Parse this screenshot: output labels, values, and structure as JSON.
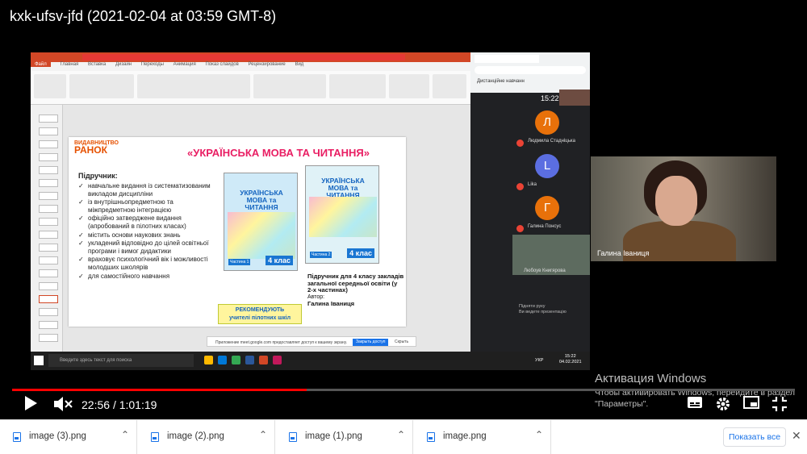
{
  "video": {
    "title": "kxk-ufsv-jfd (2021-02-04 at 03:59 GMT-8)",
    "current_time": "22:56",
    "separator": "/",
    "duration": "1:01:19",
    "progress_fraction": 0.376
  },
  "ppt": {
    "tabs": [
      "Файл",
      "Главная",
      "Вставка",
      "Дизайн",
      "Переходы",
      "Анимация",
      "Показ слайдов",
      "Рецензирование",
      "Вид"
    ],
    "slide": {
      "brand_top": "ВИДАВНИЦТВО",
      "brand": "РАНОК",
      "title": "«УКРАЇНСЬКА МОВА ТА ЧИТАННЯ»",
      "subtitle": "Підручник:",
      "bullets": [
        "навчальне видання із систематизованим викладом дисципліни",
        "із внутрішньопредметною та міжпредметною інтеграцією",
        "офіційно затверджене видання (апробований в пілотних класах)",
        "містить основи наукових знань",
        "укладений відповідно до цілей освітньої програми і вимог дидактики",
        "враховує психологічний вік і можливості молодших школярів",
        "для самостійного навчання"
      ],
      "book1_title": "УКРАЇНСЬКА МОВА та ЧИТАННЯ",
      "book1_part": "Частина 1",
      "book1_grade": "4 клас",
      "book2_title": "УКРАЇНСЬКА МОВА та ЧИТАННЯ",
      "book2_part": "Частина 2",
      "book2_grade": "4 клас",
      "recommend_1": "РЕКОМЕНДУЮТЬ",
      "recommend_2": "учителі пілотних шкіл",
      "caption": "Підручник для 4 класу закладів загальної середньої освіти (у 2-х частинах)",
      "author_label": "Автор:",
      "author": "Галина Іваниця"
    },
    "notification": {
      "text": "Приложение meet.google.com предоставляет доступ к вашему экрану.",
      "button": "Закрыть доступ",
      "close": "Скрыть"
    }
  },
  "meet": {
    "tab_label": "Дистанційне навчанн",
    "time": "15:22",
    "participants": [
      {
        "initial": "Л",
        "name": "Людмила Стадніцька",
        "color": "#e8710a"
      },
      {
        "initial": "L",
        "name": "Lika",
        "color": "#5b6ee1"
      },
      {
        "initial": "Г",
        "name": "Галина Понсус",
        "color": "#e8710a"
      }
    ],
    "mini_name": "Любоув Книгярова",
    "present_1": "Підняти руку",
    "present_2": "Ви ведете презентацію"
  },
  "taskbar": {
    "search": "Введите здесь текст для поиска",
    "lang": "УКР",
    "clock_time": "15:22",
    "clock_date": "04.02.2021"
  },
  "webcam": {
    "name": "Галина Іваниця"
  },
  "watermark": {
    "line1": "Активация Windows",
    "line2": "Чтобы активировать Windows, перейдите в раздел \"Параметры\"."
  },
  "downloads": {
    "items": [
      {
        "name": "image (3).png"
      },
      {
        "name": "image (2).png"
      },
      {
        "name": "image (1).png"
      },
      {
        "name": "image.png"
      }
    ],
    "show_all": "Показать все"
  },
  "colors": {
    "progress": "#ff0000",
    "ppt_accent": "#d24726",
    "link": "#1a73e8"
  }
}
